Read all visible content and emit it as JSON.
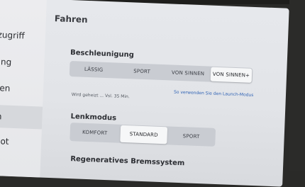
{
  "sidebar": {
    "items": [
      {
        "label": "llzugriff",
        "active": false
      },
      {
        "label": "rung",
        "active": false
      },
      {
        "label": "nten",
        "active": false
      },
      {
        "label": "en",
        "active": true
      },
      {
        "label": "pilot",
        "active": false
      }
    ]
  },
  "page": {
    "title": "Fahren"
  },
  "acceleration": {
    "heading": "Beschleunigung",
    "options": [
      "LÄSSIG",
      "SPORT",
      "VON SINNEN",
      "VON SINNEN+"
    ],
    "selected": "VON SINNEN+",
    "note": "Wird geheizt ... Vsl. 35 Min.",
    "link": "So verwenden Sie den Launch-Modus"
  },
  "steering": {
    "heading": "Lenkmodus",
    "options": [
      "KOMFORT",
      "STANDARD",
      "SPORT"
    ],
    "selected": "STANDARD"
  },
  "regen": {
    "heading": "Regeneratives Bremssystem"
  },
  "colors": {
    "accent_link": "#2f62b4",
    "panel": "#e4e6ea",
    "segment_bg": "#c9ccd2"
  }
}
